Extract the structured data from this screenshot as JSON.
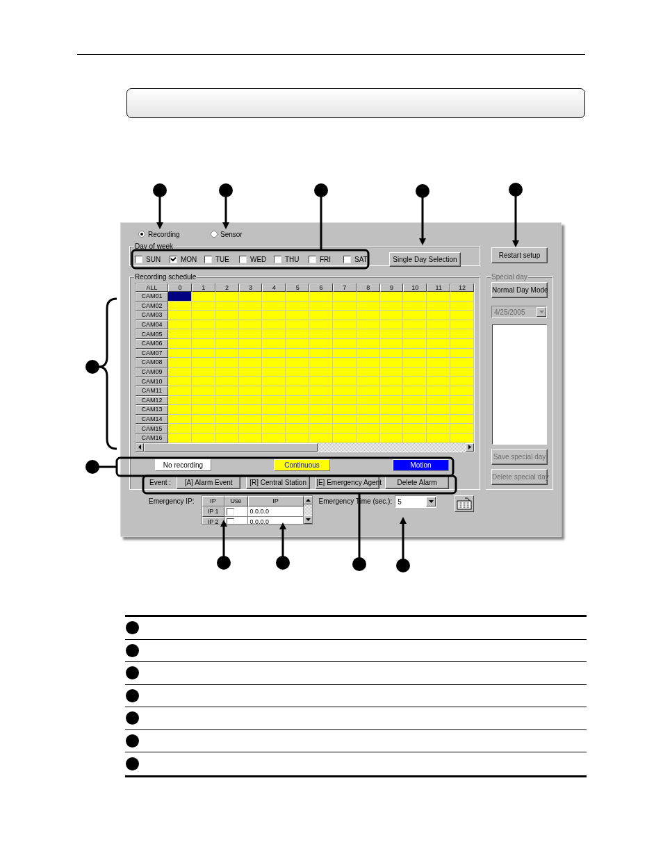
{
  "mode_radios": [
    {
      "label": "Recording",
      "selected": true
    },
    {
      "label": "Sensor",
      "selected": false
    }
  ],
  "day_of_week": {
    "title": "Day of week",
    "days": [
      {
        "label": "SUN",
        "checked": false
      },
      {
        "label": "MON",
        "checked": true
      },
      {
        "label": "TUE",
        "checked": false
      },
      {
        "label": "WED",
        "checked": false
      },
      {
        "label": "THU",
        "checked": false
      },
      {
        "label": "FRI",
        "checked": false
      },
      {
        "label": "SAT",
        "checked": false
      }
    ],
    "button": "Single Day Selection"
  },
  "restart_button": "Restart setup",
  "schedule": {
    "title": "Recording schedule",
    "corner": "ALL",
    "hours": [
      "0",
      "1",
      "2",
      "3",
      "4",
      "5",
      "6",
      "7",
      "8",
      "9",
      "10",
      "11",
      "12"
    ],
    "rows": [
      {
        "label": "CAM01",
        "kind": "continuous",
        "cells": [
          {
            "selected": true
          },
          {
            "selected": false
          },
          {
            "selected": false
          },
          {
            "selected": false
          },
          {
            "selected": false
          },
          {
            "selected": false
          },
          {
            "selected": false
          },
          {
            "selected": false
          },
          {
            "selected": false
          },
          {
            "selected": false
          },
          {
            "selected": false
          },
          {
            "selected": false
          },
          {
            "selected": false
          }
        ]
      },
      {
        "label": "CAM02",
        "kind": "continuous",
        "cells": [
          {
            "selected": false
          },
          {
            "selected": false
          },
          {
            "selected": false
          },
          {
            "selected": false
          },
          {
            "selected": false
          },
          {
            "selected": false
          },
          {
            "selected": false
          },
          {
            "selected": false
          },
          {
            "selected": false
          },
          {
            "selected": false
          },
          {
            "selected": false
          },
          {
            "selected": false
          },
          {
            "selected": false
          }
        ]
      },
      {
        "label": "CAM03",
        "kind": "continuous",
        "cells": [
          {
            "selected": false
          },
          {
            "selected": false
          },
          {
            "selected": false
          },
          {
            "selected": false
          },
          {
            "selected": false
          },
          {
            "selected": false
          },
          {
            "selected": false
          },
          {
            "selected": false
          },
          {
            "selected": false
          },
          {
            "selected": false
          },
          {
            "selected": false
          },
          {
            "selected": false
          },
          {
            "selected": false
          }
        ]
      },
      {
        "label": "CAM04",
        "kind": "continuous",
        "cells": [
          {
            "selected": false
          },
          {
            "selected": false
          },
          {
            "selected": false
          },
          {
            "selected": false
          },
          {
            "selected": false
          },
          {
            "selected": false
          },
          {
            "selected": false
          },
          {
            "selected": false
          },
          {
            "selected": false
          },
          {
            "selected": false
          },
          {
            "selected": false
          },
          {
            "selected": false
          },
          {
            "selected": false
          }
        ]
      },
      {
        "label": "CAM05",
        "kind": "continuous",
        "cells": [
          {
            "selected": false
          },
          {
            "selected": false
          },
          {
            "selected": false
          },
          {
            "selected": false
          },
          {
            "selected": false
          },
          {
            "selected": false
          },
          {
            "selected": false
          },
          {
            "selected": false
          },
          {
            "selected": false
          },
          {
            "selected": false
          },
          {
            "selected": false
          },
          {
            "selected": false
          },
          {
            "selected": false
          }
        ]
      },
      {
        "label": "CAM06",
        "kind": "continuous",
        "cells": [
          {
            "selected": false
          },
          {
            "selected": false
          },
          {
            "selected": false
          },
          {
            "selected": false
          },
          {
            "selected": false
          },
          {
            "selected": false
          },
          {
            "selected": false
          },
          {
            "selected": false
          },
          {
            "selected": false
          },
          {
            "selected": false
          },
          {
            "selected": false
          },
          {
            "selected": false
          },
          {
            "selected": false
          }
        ]
      },
      {
        "label": "CAM07",
        "kind": "continuous",
        "cells": [
          {
            "selected": false
          },
          {
            "selected": false
          },
          {
            "selected": false
          },
          {
            "selected": false
          },
          {
            "selected": false
          },
          {
            "selected": false
          },
          {
            "selected": false
          },
          {
            "selected": false
          },
          {
            "selected": false
          },
          {
            "selected": false
          },
          {
            "selected": false
          },
          {
            "selected": false
          },
          {
            "selected": false
          }
        ]
      },
      {
        "label": "CAM08",
        "kind": "continuous",
        "cells": [
          {
            "selected": false
          },
          {
            "selected": false
          },
          {
            "selected": false
          },
          {
            "selected": false
          },
          {
            "selected": false
          },
          {
            "selected": false
          },
          {
            "selected": false
          },
          {
            "selected": false
          },
          {
            "selected": false
          },
          {
            "selected": false
          },
          {
            "selected": false
          },
          {
            "selected": false
          },
          {
            "selected": false
          }
        ]
      },
      {
        "label": "CAM09",
        "kind": "continuous",
        "cells": [
          {
            "selected": false
          },
          {
            "selected": false
          },
          {
            "selected": false
          },
          {
            "selected": false
          },
          {
            "selected": false
          },
          {
            "selected": false
          },
          {
            "selected": false
          },
          {
            "selected": false
          },
          {
            "selected": false
          },
          {
            "selected": false
          },
          {
            "selected": false
          },
          {
            "selected": false
          },
          {
            "selected": false
          }
        ]
      },
      {
        "label": "CAM10",
        "kind": "continuous",
        "cells": [
          {
            "selected": false
          },
          {
            "selected": false
          },
          {
            "selected": false
          },
          {
            "selected": false
          },
          {
            "selected": false
          },
          {
            "selected": false
          },
          {
            "selected": false
          },
          {
            "selected": false
          },
          {
            "selected": false
          },
          {
            "selected": false
          },
          {
            "selected": false
          },
          {
            "selected": false
          },
          {
            "selected": false
          }
        ]
      },
      {
        "label": "CAM11",
        "kind": "continuous",
        "cells": [
          {
            "selected": false
          },
          {
            "selected": false
          },
          {
            "selected": false
          },
          {
            "selected": false
          },
          {
            "selected": false
          },
          {
            "selected": false
          },
          {
            "selected": false
          },
          {
            "selected": false
          },
          {
            "selected": false
          },
          {
            "selected": false
          },
          {
            "selected": false
          },
          {
            "selected": false
          },
          {
            "selected": false
          }
        ]
      },
      {
        "label": "CAM12",
        "kind": "continuous",
        "cells": [
          {
            "selected": false
          },
          {
            "selected": false
          },
          {
            "selected": false
          },
          {
            "selected": false
          },
          {
            "selected": false
          },
          {
            "selected": false
          },
          {
            "selected": false
          },
          {
            "selected": false
          },
          {
            "selected": false
          },
          {
            "selected": false
          },
          {
            "selected": false
          },
          {
            "selected": false
          },
          {
            "selected": false
          }
        ]
      },
      {
        "label": "CAM13",
        "kind": "continuous",
        "cells": [
          {
            "selected": false
          },
          {
            "selected": false
          },
          {
            "selected": false
          },
          {
            "selected": false
          },
          {
            "selected": false
          },
          {
            "selected": false
          },
          {
            "selected": false
          },
          {
            "selected": false
          },
          {
            "selected": false
          },
          {
            "selected": false
          },
          {
            "selected": false
          },
          {
            "selected": false
          },
          {
            "selected": false
          }
        ]
      },
      {
        "label": "CAM14",
        "kind": "continuous",
        "cells": [
          {
            "selected": false
          },
          {
            "selected": false
          },
          {
            "selected": false
          },
          {
            "selected": false
          },
          {
            "selected": false
          },
          {
            "selected": false
          },
          {
            "selected": false
          },
          {
            "selected": false
          },
          {
            "selected": false
          },
          {
            "selected": false
          },
          {
            "selected": false
          },
          {
            "selected": false
          },
          {
            "selected": false
          }
        ]
      },
      {
        "label": "CAM15",
        "kind": "continuous",
        "cells": [
          {
            "selected": false
          },
          {
            "selected": false
          },
          {
            "selected": false
          },
          {
            "selected": false
          },
          {
            "selected": false
          },
          {
            "selected": false
          },
          {
            "selected": false
          },
          {
            "selected": false
          },
          {
            "selected": false
          },
          {
            "selected": false
          },
          {
            "selected": false
          },
          {
            "selected": false
          },
          {
            "selected": false
          }
        ]
      },
      {
        "label": "CAM16",
        "kind": "continuous",
        "cells": [
          {
            "selected": false
          },
          {
            "selected": false
          },
          {
            "selected": false
          },
          {
            "selected": false
          },
          {
            "selected": false
          },
          {
            "selected": false
          },
          {
            "selected": false
          },
          {
            "selected": false
          },
          {
            "selected": false
          },
          {
            "selected": false
          },
          {
            "selected": false
          },
          {
            "selected": false
          },
          {
            "selected": false
          }
        ]
      }
    ]
  },
  "legend": [
    {
      "kind": "none",
      "label": "No recording",
      "color": "#ffffff"
    },
    {
      "kind": "continuous",
      "label": "Continuous",
      "color": "#ffff00"
    },
    {
      "kind": "motion",
      "label": "Motion",
      "color": "#0000ff"
    }
  ],
  "events": {
    "label": "Event :",
    "buttons": [
      "[A] Alarm Event",
      "[R] Central Station",
      "[E] Emergency Agent",
      "Delete Alarm"
    ]
  },
  "special_day": {
    "title": "Special day",
    "mode_button": "Normal Day Mode",
    "date": "4/25/2005",
    "date_disabled": true,
    "buttons": [
      {
        "label": "Save special day",
        "disabled": true
      },
      {
        "label": "Delete special day",
        "disabled": true
      }
    ]
  },
  "emergency_ip": {
    "label": "Emergency IP:",
    "columns": [
      "IP",
      "Use",
      "IP"
    ],
    "rows": [
      {
        "name": "IP 1",
        "use": false,
        "ip": "0.0.0.0"
      },
      {
        "name": "IP 2",
        "use": false,
        "ip": "0.0.0.0"
      }
    ]
  },
  "emergency_time": {
    "label": "Emergency Time (sec.):",
    "value": "5"
  },
  "description_rows": [
    {
      "kind": "marker"
    },
    {
      "kind": "marker"
    },
    {
      "kind": "marker"
    },
    {
      "kind": "marker"
    },
    {
      "kind": "marker"
    },
    {
      "kind": "marker"
    },
    {
      "kind": "marker"
    }
  ]
}
